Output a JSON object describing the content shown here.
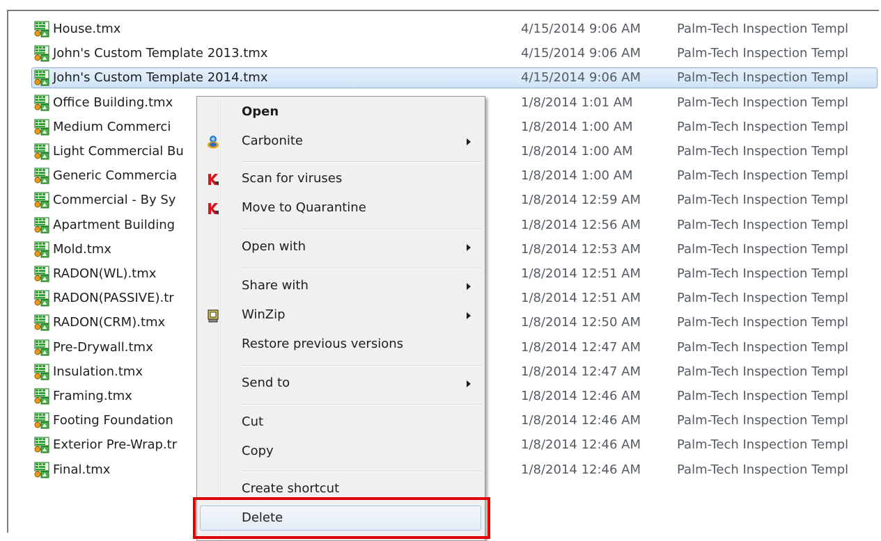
{
  "files": [
    {
      "name": "House.tmx",
      "date": "4/15/2014 9:06 AM",
      "type": "Palm-Tech Inspection Templ"
    },
    {
      "name": "John's Custom Template 2013.tmx",
      "date": "4/15/2014 9:06 AM",
      "type": "Palm-Tech Inspection Templ"
    },
    {
      "name": "John's Custom Template 2014.tmx",
      "date": "4/15/2014 9:06 AM",
      "type": "Palm-Tech Inspection Templ",
      "selected": true
    },
    {
      "name": "Office Building.tmx",
      "date": "1/8/2014 1:01 AM",
      "type": "Palm-Tech Inspection Templ"
    },
    {
      "name": "Medium Commerci",
      "date": "1/8/2014 1:00 AM",
      "type": "Palm-Tech Inspection Templ"
    },
    {
      "name": "Light Commercial Bu",
      "date": "1/8/2014 1:00 AM",
      "type": "Palm-Tech Inspection Templ"
    },
    {
      "name": "Generic Commercia",
      "date": "1/8/2014 1:00 AM",
      "type": "Palm-Tech Inspection Templ"
    },
    {
      "name": "Commercial - By Sy",
      "date": "1/8/2014 12:59 AM",
      "type": "Palm-Tech Inspection Templ"
    },
    {
      "name": "Apartment Building",
      "date": "1/8/2014 12:56 AM",
      "type": "Palm-Tech Inspection Templ"
    },
    {
      "name": "Mold.tmx",
      "date": "1/8/2014 12:53 AM",
      "type": "Palm-Tech Inspection Templ"
    },
    {
      "name": "RADON(WL).tmx",
      "date": "1/8/2014 12:51 AM",
      "type": "Palm-Tech Inspection Templ"
    },
    {
      "name": "RADON(PASSIVE).tr",
      "date": "1/8/2014 12:51 AM",
      "type": "Palm-Tech Inspection Templ"
    },
    {
      "name": "RADON(CRM).tmx",
      "date": "1/8/2014 12:50 AM",
      "type": "Palm-Tech Inspection Templ"
    },
    {
      "name": "Pre-Drywall.tmx",
      "date": "1/8/2014 12:47 AM",
      "type": "Palm-Tech Inspection Templ"
    },
    {
      "name": "Insulation.tmx",
      "date": "1/8/2014 12:47 AM",
      "type": "Palm-Tech Inspection Templ"
    },
    {
      "name": "Framing.tmx",
      "date": "1/8/2014 12:46 AM",
      "type": "Palm-Tech Inspection Templ"
    },
    {
      "name": "Footing Foundation",
      "date": "1/8/2014 12:46 AM",
      "type": "Palm-Tech Inspection Templ"
    },
    {
      "name": "Exterior Pre-Wrap.tr",
      "date": "1/8/2014 12:46 AM",
      "type": "Palm-Tech Inspection Templ"
    },
    {
      "name": "Final.tmx",
      "date": "1/8/2014 12:46 AM",
      "type": "Palm-Tech Inspection Templ"
    }
  ],
  "context_menu": {
    "open": "Open",
    "carbonite": "Carbonite",
    "scan_viruses": "Scan for viruses",
    "move_quarantine": "Move to Quarantine",
    "open_with": "Open with",
    "share_with": "Share with",
    "winzip": "WinZip",
    "restore_versions": "Restore previous versions",
    "send_to": "Send to",
    "cut": "Cut",
    "copy": "Copy",
    "create_shortcut": "Create shortcut",
    "delete": "Delete"
  },
  "colors": {
    "highlight_box": "#e00000",
    "selection": "#cfe4f8",
    "menu_bg": "#f0f0f0"
  }
}
